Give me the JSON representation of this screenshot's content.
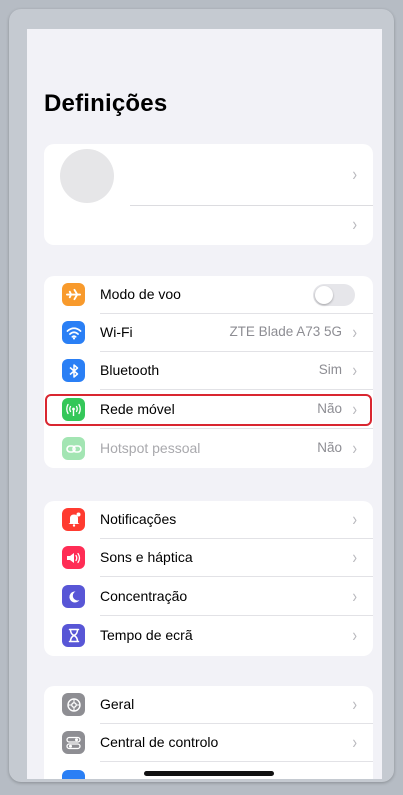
{
  "page": {
    "title": "Definições"
  },
  "colors": {
    "orange": "#f89a2c",
    "blue": "#2a7ff5",
    "green": "#34c759",
    "red": "#ff3b30",
    "pink": "#ff2d55",
    "indigo": "#5856d6",
    "gray": "#8e8e93",
    "highlight": "#d92630"
  },
  "connectivity": {
    "airplane_label": "Modo de voo",
    "airplane_on": false,
    "wifi_label": "Wi-Fi",
    "wifi_value": "ZTE Blade A73 5G",
    "bluetooth_label": "Bluetooth",
    "bluetooth_value": "Sim",
    "cellular_label": "Rede móvel",
    "cellular_value": "Não",
    "hotspot_label": "Hotspot pessoal",
    "hotspot_value": "Não"
  },
  "notifications_group": {
    "notifications_label": "Notificações",
    "sounds_label": "Sons e háptica",
    "focus_label": "Concentração",
    "screentime_label": "Tempo de ecrã"
  },
  "general_group": {
    "general_label": "Geral",
    "control_center_label": "Central de controlo"
  },
  "chevron": "›"
}
